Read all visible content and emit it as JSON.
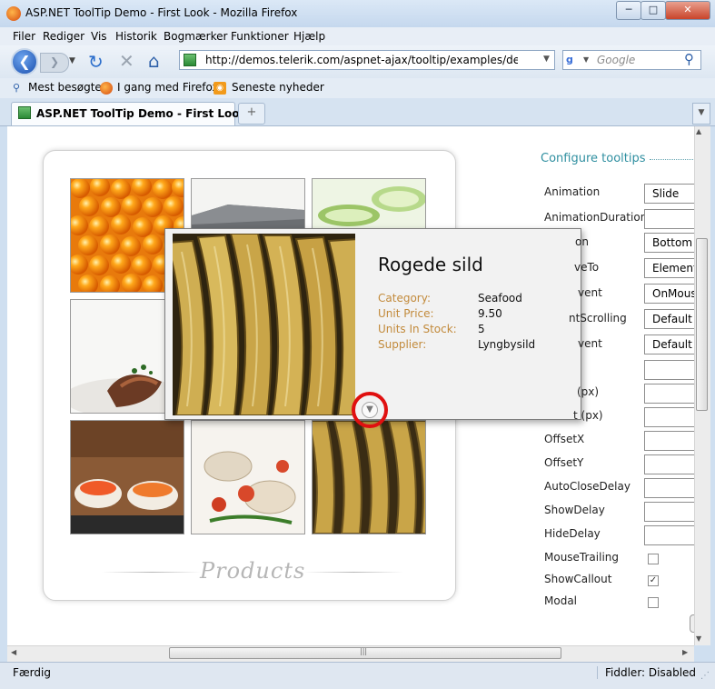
{
  "window": {
    "title": "ASP.NET ToolTip Demo - First Look - Mozilla Firefox",
    "minimize": "─",
    "maximize": "□",
    "close": "✕"
  },
  "menu": [
    "Filer",
    "Rediger",
    "Vis",
    "Historik",
    "Bogmærker",
    "Funktioner",
    "Hjælp"
  ],
  "nav": {
    "url": "http://demos.telerik.com/aspnet-ajax/tooltip/examples/default/d",
    "search_placeholder": "Google"
  },
  "bookmarks": [
    "Mest besøgte",
    "I gang med Firefox",
    "Seneste nyheder"
  ],
  "tab": {
    "label": "ASP.NET ToolTip Demo - First Look",
    "new_tab": "+"
  },
  "status": {
    "text": "Færdig",
    "fiddler": "Fiddler: Disabled"
  },
  "products": {
    "caption": "Products"
  },
  "tooltip": {
    "title": "Rogede sild",
    "fields": [
      {
        "label": "Category:",
        "value": "Seafood"
      },
      {
        "label": "Unit Price:",
        "value": "9.50"
      },
      {
        "label": "Units In Stock:",
        "value": "5"
      },
      {
        "label": "Supplier:",
        "value": "Lyngbysild"
      }
    ]
  },
  "config": {
    "title": "Configure tooltips",
    "rows": [
      {
        "label": "Animation",
        "type": "select",
        "value": "Slide"
      },
      {
        "label": "AnimationDuration",
        "type": "input",
        "value": ""
      },
      {
        "label": "on",
        "type": "select",
        "value": "Bottom"
      },
      {
        "label": "veTo",
        "type": "select",
        "value": "Element"
      },
      {
        "label": "vent",
        "type": "select",
        "value": "OnMous"
      },
      {
        "label": "ntScrolling",
        "type": "select",
        "value": "Default"
      },
      {
        "label": "vent",
        "type": "select",
        "value": "Default"
      },
      {
        "label": "",
        "type": "input",
        "value": ""
      },
      {
        "label": "(px)",
        "type": "input",
        "value": ""
      },
      {
        "label": "t (px)",
        "type": "input",
        "value": ""
      },
      {
        "label": "OffsetX",
        "type": "input",
        "value": ""
      },
      {
        "label": "OffsetY",
        "type": "input",
        "value": ""
      },
      {
        "label": "AutoCloseDelay",
        "type": "input",
        "value": ""
      },
      {
        "label": "ShowDelay",
        "type": "input",
        "value": ""
      },
      {
        "label": "HideDelay",
        "type": "input",
        "value": ""
      },
      {
        "label": "MouseTrailing",
        "type": "checkbox",
        "checked": false
      },
      {
        "label": "ShowCallout",
        "type": "checkbox",
        "checked": true
      },
      {
        "label": "Modal",
        "type": "checkbox",
        "checked": false
      }
    ]
  }
}
